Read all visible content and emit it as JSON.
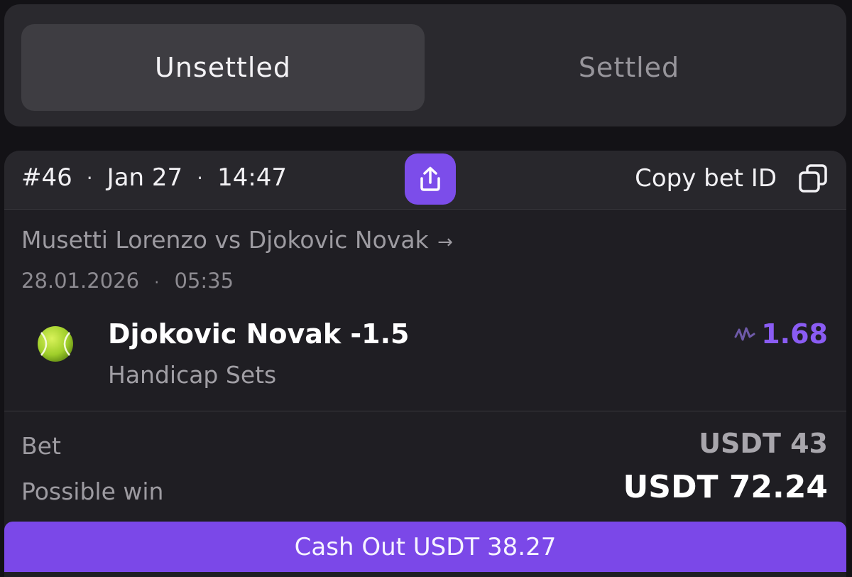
{
  "tabs": [
    {
      "label": "Unsettled",
      "active": true
    },
    {
      "label": "Settled",
      "active": false
    }
  ],
  "bet": {
    "number": "#46",
    "date": "Jan 27",
    "time": "14:47",
    "separator": "·",
    "copy_label": "Copy bet ID",
    "share_icon": "share-icon",
    "copy_icon": "copy-icon"
  },
  "match": {
    "title": "Musetti Lorenzo vs Djokovic Novak",
    "arrow": "→",
    "date": "28.01.2026",
    "separator": "·",
    "time": "05:35"
  },
  "selection": {
    "sport_icon": "tennis-ball-icon",
    "name": "Djokovic Novak -1.5",
    "market": "Handicap Sets",
    "odds": "1.68",
    "odds_trend_icon": "odds-trend-icon"
  },
  "stake": {
    "bet_label": "Bet",
    "bet_amount": "USDT 43",
    "win_label": "Possible win",
    "win_amount": "USDT 72.24"
  },
  "cashout": {
    "label": "Cash Out USDT 38.27"
  },
  "colors": {
    "accent": "#7c4dea",
    "odds": "#8a5cf3",
    "background": "#131216",
    "card": "#1f1e23"
  }
}
